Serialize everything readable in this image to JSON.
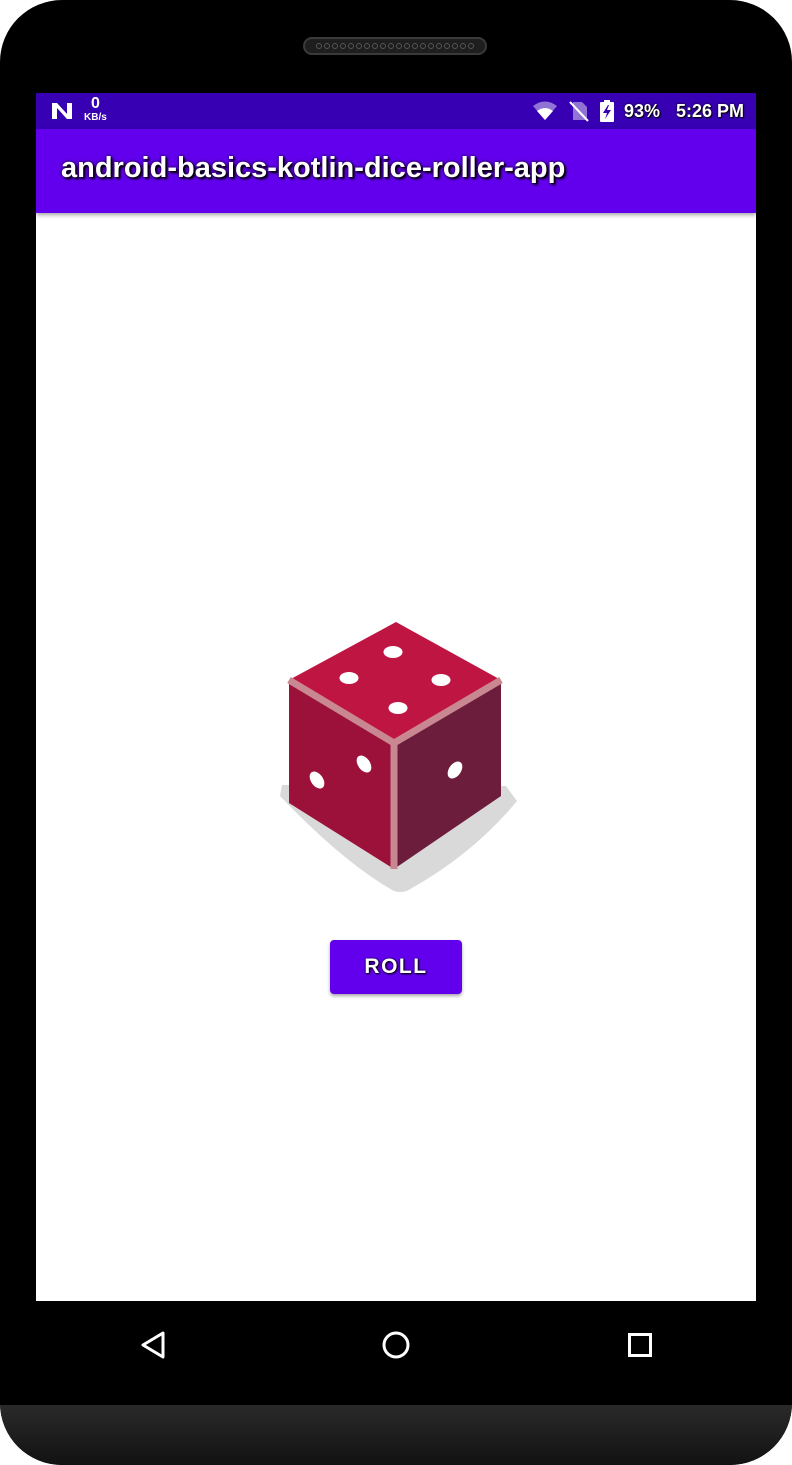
{
  "status_bar": {
    "net_speed_value": "0",
    "net_speed_unit": "KB/s",
    "battery": "93%",
    "time": "5:26 PM",
    "background_color": "#3700b3"
  },
  "app_bar": {
    "title": "android-basics-kotlin-dice-roller-app",
    "background_color": "#6200ee"
  },
  "main": {
    "dice_face_value": 4,
    "roll_button_label": "ROLL"
  },
  "nav_bar": {
    "icons": [
      "back-icon",
      "home-icon",
      "recents-icon"
    ]
  }
}
